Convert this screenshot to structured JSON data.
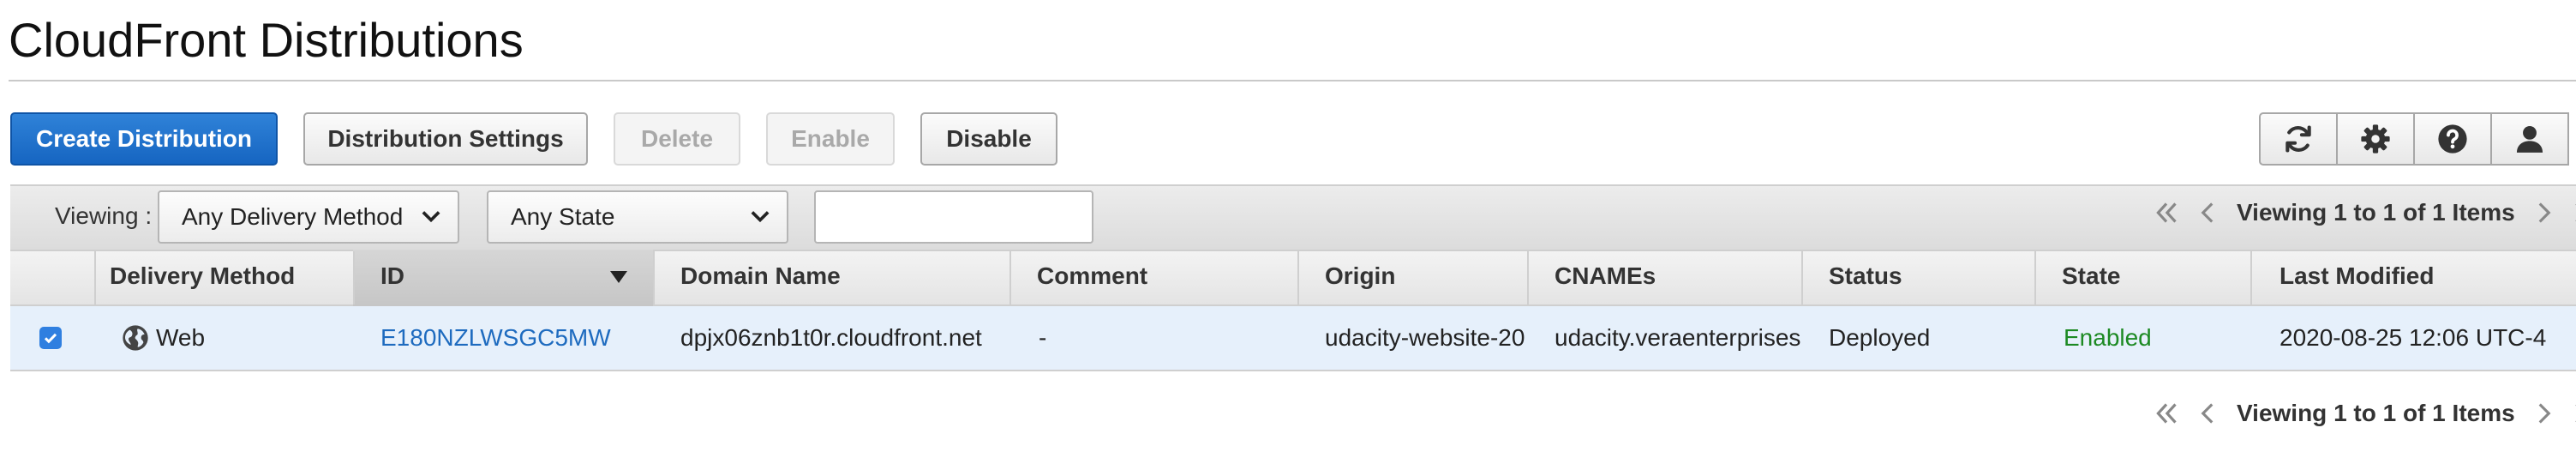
{
  "page": {
    "title": "CloudFront Distributions"
  },
  "toolbar": {
    "create_label": "Create Distribution",
    "settings_label": "Distribution Settings",
    "delete_label": "Delete",
    "enable_label": "Enable",
    "disable_label": "Disable",
    "icons": [
      "refresh-icon",
      "gear-icon",
      "help-icon",
      "user-icon"
    ]
  },
  "filters": {
    "viewing_label": "Viewing :",
    "delivery_method": "Any Delivery Method",
    "state": "Any State",
    "search_value": ""
  },
  "pagination": {
    "top_text": "Viewing 1 to 1 of 1 Items",
    "bottom_text": "Viewing 1 to 1 of 1 Items"
  },
  "table": {
    "columns": [
      "Delivery Method",
      "ID",
      "Domain Name",
      "Comment",
      "Origin",
      "CNAMEs",
      "Status",
      "State",
      "Last Modified"
    ],
    "sorted_column": "ID",
    "rows": [
      {
        "selected": true,
        "delivery_method": "Web",
        "id": "E180NZLWSGC5MW",
        "domain_name": "dpjx06znb1t0r.cloudfront.net",
        "comment": "-",
        "origin": "udacity-website-20",
        "cnames": "udacity.veraenterprises",
        "status": "Deployed",
        "state": "Enabled",
        "last_modified": "2020-08-25 12:06 UTC-4"
      }
    ]
  },
  "colors": {
    "primary": "#1665c1",
    "link": "#1e6bbf",
    "enabled": "#1d8a23",
    "row_selected": "#e6f0fb"
  }
}
